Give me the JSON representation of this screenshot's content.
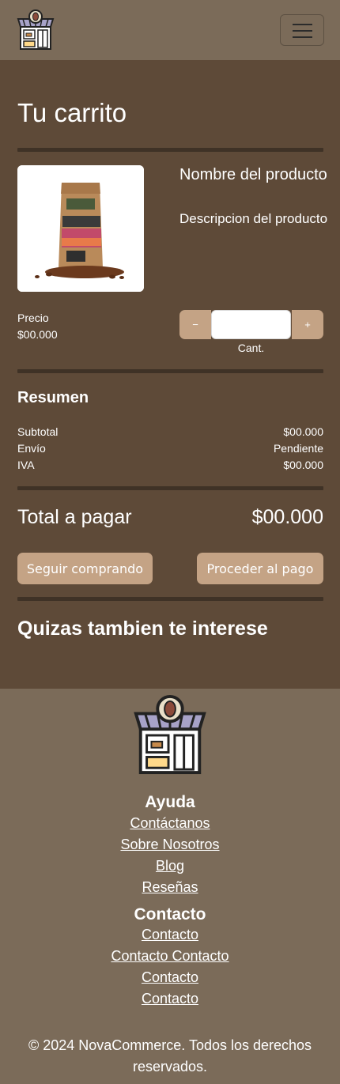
{
  "navbar": {
    "logo_icon": "coffee-shop-logo-icon",
    "menu_icon": "hamburger-menu-icon"
  },
  "cart": {
    "title": "Tu carrito",
    "item": {
      "image_icon": "coffee-bag-image",
      "name": "Nombre del producto",
      "description": "Descripcion del producto",
      "price_label": "Precio",
      "price_value": "$00.000",
      "minus_label": "−",
      "plus_label": "+",
      "quantity_value": "",
      "quantity_label": "Cant."
    }
  },
  "summary": {
    "title": "Resumen",
    "rows": [
      {
        "label": "Subtotal",
        "value": "$00.000"
      },
      {
        "label": "Envío",
        "value": "Pendiente"
      },
      {
        "label": "IVA",
        "value": "$00.000"
      }
    ],
    "total_label": "Total a pagar",
    "total_value": "$00.000"
  },
  "actions": {
    "continue_label": "Seguir comprando",
    "checkout_label": "Proceder al pago"
  },
  "recommendations": {
    "title": "Quizas tambien te interese"
  },
  "footer": {
    "logo_icon": "coffee-shop-logo-icon",
    "help_title": "Ayuda",
    "help_links": [
      "Contáctanos",
      "Sobre Nosotros",
      "Blog",
      "Reseñas"
    ],
    "contact_title": "Contacto",
    "contact_links": [
      "Contacto",
      "Contacto Contacto",
      "Contacto",
      "Contacto"
    ],
    "copyright": "© 2024 NovaCommerce. Todos los derechos reservados."
  },
  "colors": {
    "page_bg": "#5e4a38",
    "header_bg": "#7b6b59",
    "button_bg": "#c4a385",
    "divider": "#3f3226"
  }
}
